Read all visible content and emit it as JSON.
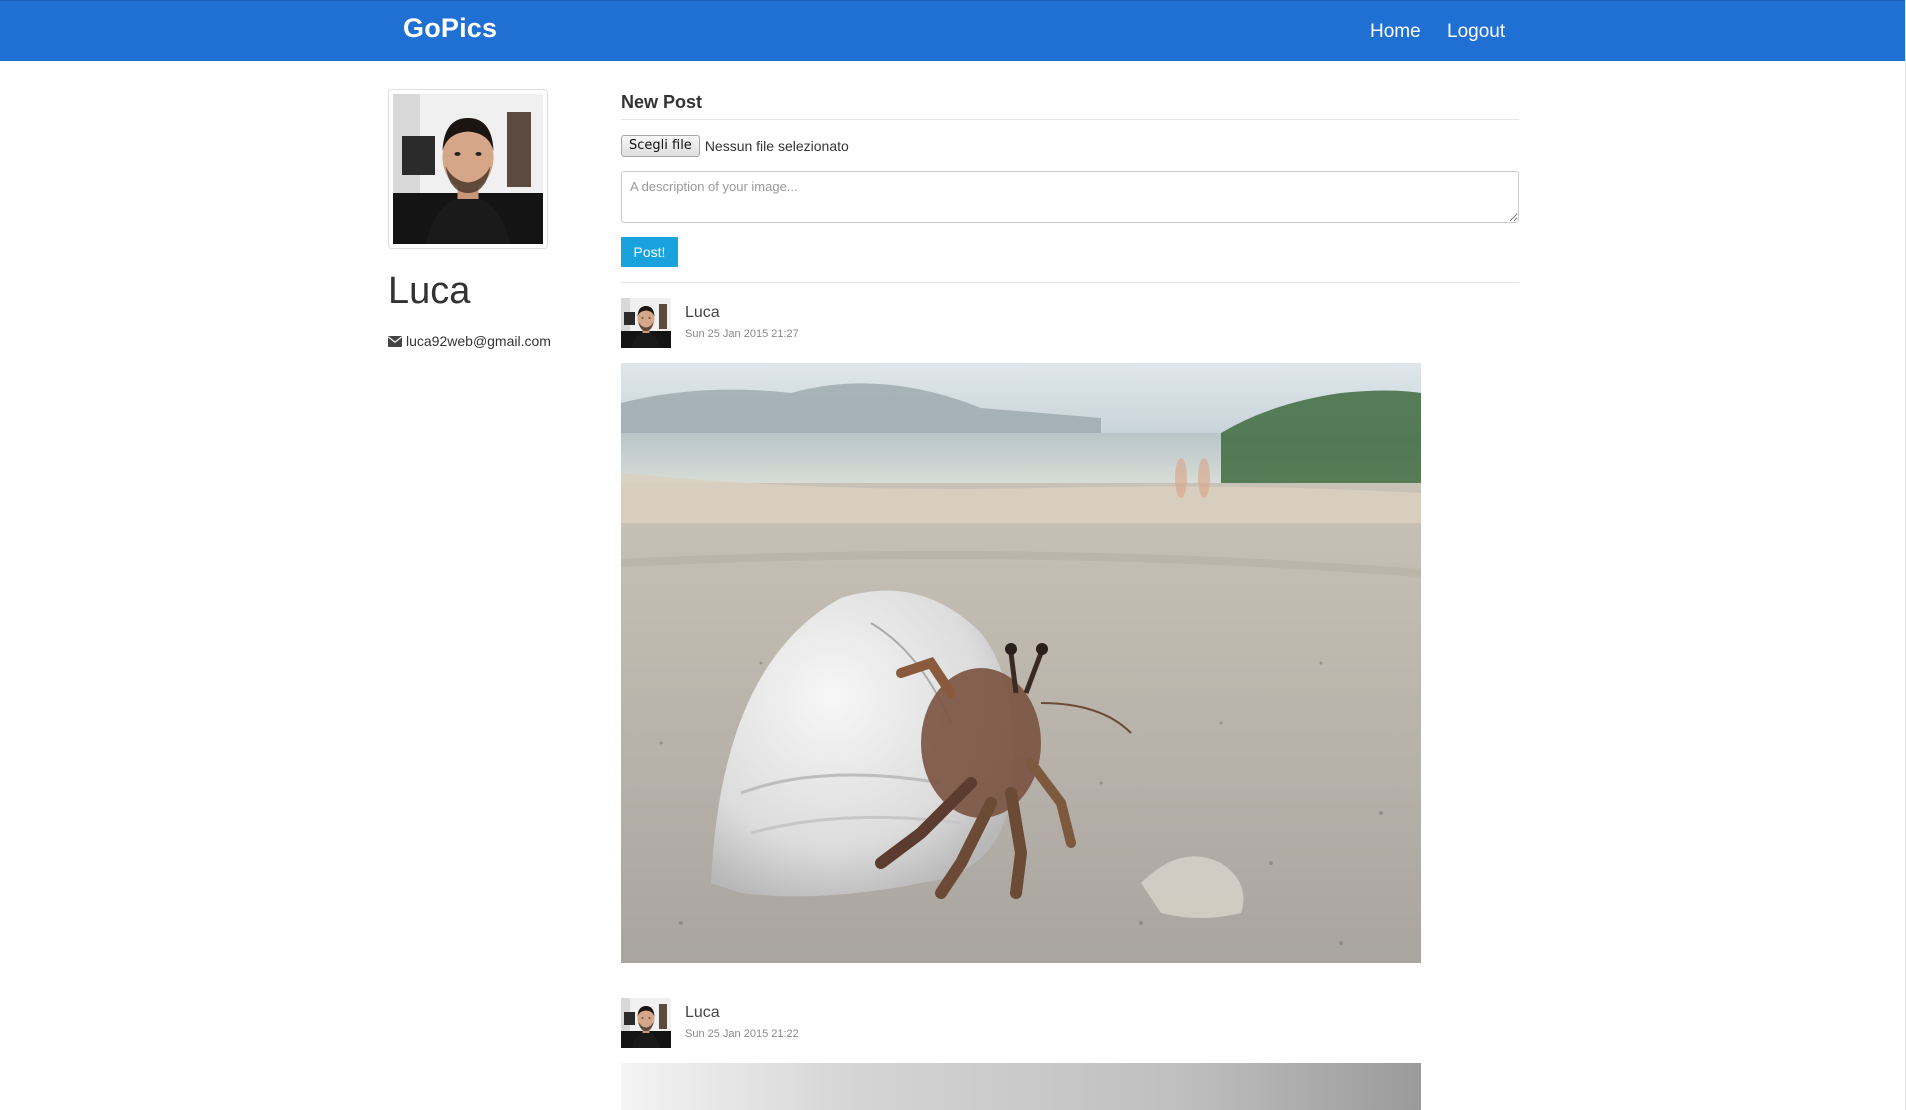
{
  "navbar": {
    "brand": "GoPics",
    "links": [
      {
        "label": "Home"
      },
      {
        "label": "Logout"
      }
    ]
  },
  "profile": {
    "name": "Luca",
    "email": "luca92web@gmail.com",
    "avatar_icon": "user-photo",
    "email_icon": "envelope-icon"
  },
  "new_post": {
    "title": "New Post",
    "file_button_label": "Scegli file",
    "file_status": "Nessun file selezionato",
    "description_placeholder": "A description of your image...",
    "description_value": "",
    "submit_label": "Post!"
  },
  "posts": [
    {
      "author": "Luca",
      "timestamp": "Sun 25 Jan 2015 21:27",
      "image_subject": "hermit crab on beach sand"
    },
    {
      "author": "Luca",
      "timestamp": "Sun 25 Jan 2015 21:22",
      "image_subject": "grayscale photo"
    }
  ],
  "colors": {
    "navbar": "#206fd3",
    "post_button": "#1aa2df",
    "text": "#333333"
  }
}
